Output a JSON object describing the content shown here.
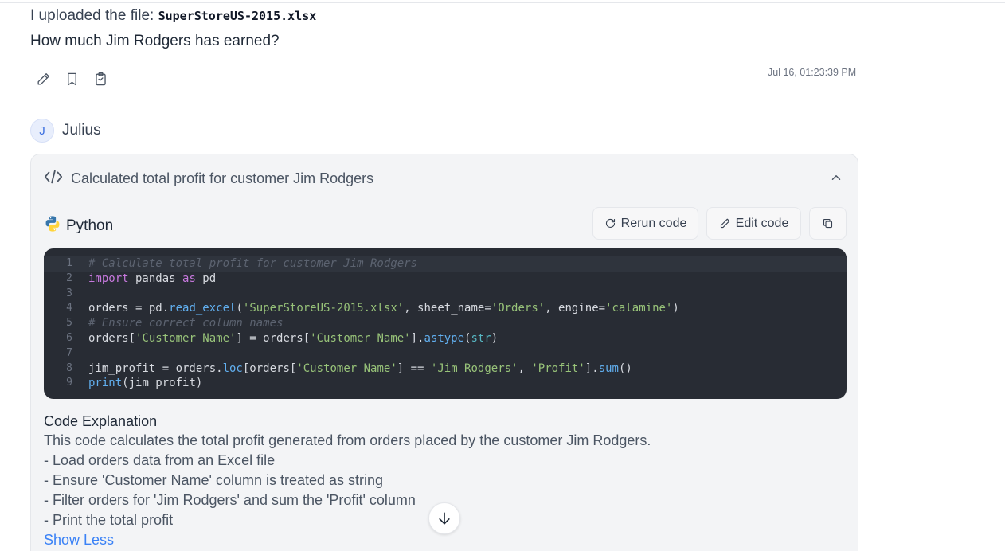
{
  "user_message": {
    "upload_prefix": "I uploaded the file: ",
    "file_name": "SuperStoreUS-2015.xlsx",
    "question": "How much Jim Rodgers has earned?",
    "timestamp": "Jul 16, 01:23:39 PM",
    "action_icons": [
      "pencil-icon",
      "bookmark-icon",
      "clipboard-icon"
    ]
  },
  "assistant": {
    "avatar_letter": "J",
    "name": "Julius"
  },
  "code_panel": {
    "title": "Calculated total profit for customer Jim Rodgers",
    "language": "Python",
    "rerun_label": "Rerun code",
    "edit_label": "Edit code",
    "line_numbers": [
      "1",
      "2",
      "3",
      "4",
      "5",
      "6",
      "7",
      "8",
      "9"
    ],
    "code_lines": [
      "# Calculate total profit for customer Jim Rodgers",
      "import pandas as pd",
      "",
      "orders = pd.read_excel('SuperStoreUS-2015.xlsx', sheet_name='Orders', engine='calamine')",
      "# Ensure correct column names",
      "orders['Customer Name'] = orders['Customer Name'].astype(str)",
      "",
      "jim_profit = orders.loc[orders['Customer Name'] == 'Jim Rodgers', 'Profit'].sum()",
      "print(jim_profit)"
    ]
  },
  "explanation": {
    "title": "Code Explanation",
    "summary": "This code calculates the total profit generated from orders placed by the customer Jim Rodgers.",
    "bullets": [
      "- Load orders data from an Excel file",
      "- Ensure 'Customer Name' column is treated as string",
      "- Filter orders for 'Jim Rodgers' and sum the 'Profit' column",
      "- Print the total profit"
    ],
    "toggle_label": "Show Less"
  },
  "colors": {
    "code_bg": "#282c34",
    "accent": "#3b82f6",
    "panel_bg": "#f3f4f6"
  }
}
